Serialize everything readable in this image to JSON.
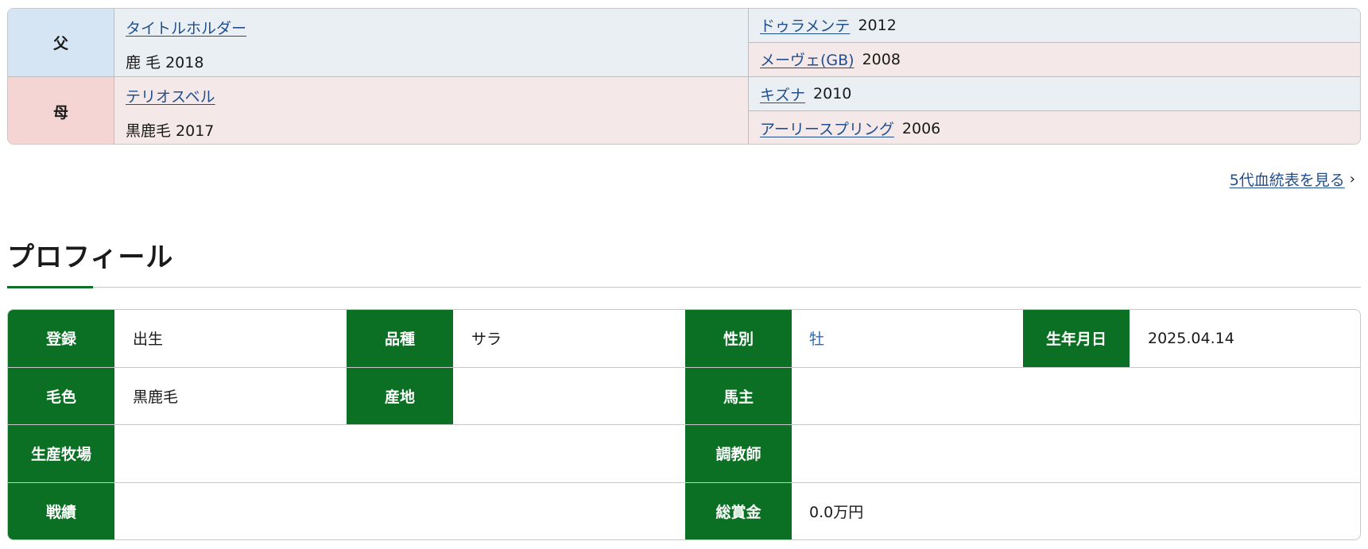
{
  "pedigree": {
    "sire": {
      "label": "父",
      "name": "タイトルホルダー",
      "detail": "鹿 毛 2018",
      "grandsire": {
        "name": "ドゥラメンテ",
        "year": "2012"
      },
      "granddam": {
        "name": "メーヴェ(GB)",
        "year": "2008"
      }
    },
    "dam": {
      "label": "母",
      "name": "テリオスベル",
      "detail": "黒鹿毛 2017",
      "grandsire": {
        "name": "キズナ",
        "year": "2010"
      },
      "granddam": {
        "name": "アーリースプリング",
        "year": "2006"
      }
    }
  },
  "five_gen_link": "5代血統表を見る",
  "profile": {
    "title": "プロフィール",
    "registration_label": "登録",
    "registration_value": "出生",
    "breed_label": "品種",
    "breed_value": "サラ",
    "sex_label": "性別",
    "sex_value": "牡",
    "birthdate_label": "生年月日",
    "birthdate_value": "2025.04.14",
    "color_label": "毛色",
    "color_value": "黒鹿毛",
    "origin_label": "産地",
    "origin_value": "",
    "owner_label": "馬主",
    "owner_value": "",
    "breeder_label": "生産牧場",
    "breeder_value": "",
    "trainer_label": "調教師",
    "trainer_value": "",
    "record_label": "戦績",
    "record_value": "",
    "prize_label": "総賞金",
    "prize_value": "0.0万円"
  },
  "colors": {
    "label_green": "#0b7023",
    "sire_blue": "#d5e5f3",
    "dam_pink": "#f5d4d4",
    "link": "#1f4f8f"
  }
}
